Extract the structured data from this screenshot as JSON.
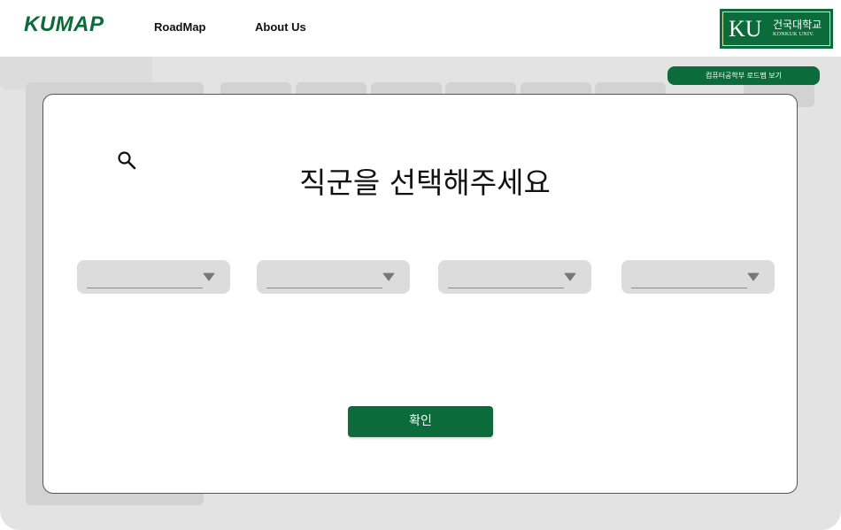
{
  "header": {
    "logo": "KUMAP",
    "nav": [
      {
        "label": "RoadMap"
      },
      {
        "label": "About Us"
      }
    ],
    "university_badge": {
      "letters": "KU",
      "name": "건국대학교",
      "sub": "KONKUK UNIV."
    }
  },
  "roadmap_button": {
    "label": "컴퓨터공학부 로드맵 보기"
  },
  "modal": {
    "title": "직군을 선택해주세요",
    "selects": [
      {
        "value": ""
      },
      {
        "value": ""
      },
      {
        "value": ""
      },
      {
        "value": ""
      }
    ],
    "confirm_label": "확인"
  },
  "colors": {
    "brand_green": "#0b6b3a",
    "backdrop_gray": "#e3e3e3",
    "select_gray": "#dcdcdc"
  },
  "icons": [
    "search-icon",
    "dropdown-caret-icon"
  ]
}
